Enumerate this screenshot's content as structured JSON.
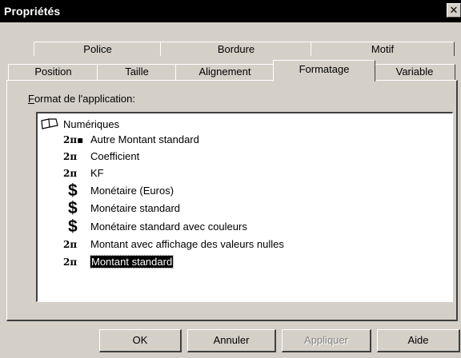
{
  "window": {
    "title": "Propriétés",
    "close_glyph": "✕"
  },
  "tabs": {
    "back_row": [
      {
        "label": "Police"
      },
      {
        "label": "Bordure"
      },
      {
        "label": "Motif"
      }
    ],
    "front_row": [
      {
        "label": "Position"
      },
      {
        "label": "Taille"
      },
      {
        "label": "Alignement"
      },
      {
        "label": "Formatage",
        "selected": true
      },
      {
        "label": "Variable"
      }
    ]
  },
  "section": {
    "label_first": "F",
    "label_rest": "ormat de l'application:"
  },
  "tree": {
    "root": {
      "label": "Numériques",
      "icon": "book-icon"
    },
    "items": [
      {
        "icon_text": "2π▪",
        "icon": "two-pi-icon",
        "label": "Autre Montant standard"
      },
      {
        "icon_text": "2π",
        "icon": "two-pi-icon",
        "label": "Coefficient"
      },
      {
        "icon_text": "2π",
        "icon": "two-pi-icon",
        "label": "KF"
      },
      {
        "icon_text": "$",
        "icon": "dollar-icon",
        "label": "Monétaire (Euros)"
      },
      {
        "icon_text": "$",
        "icon": "dollar-icon",
        "label": "Monétaire standard"
      },
      {
        "icon_text": "$",
        "icon": "dollar-icon",
        "label": "Monétaire standard avec couleurs"
      },
      {
        "icon_text": "2π",
        "icon": "two-pi-icon",
        "label": "Montant avec affichage des valeurs nulles"
      },
      {
        "icon_text": "2π",
        "icon": "two-pi-icon",
        "label": "Montant standard",
        "selected": true
      }
    ]
  },
  "buttons": {
    "ok": "OK",
    "cancel": "Annuler",
    "apply": "Appliquer",
    "help": "Aide"
  }
}
